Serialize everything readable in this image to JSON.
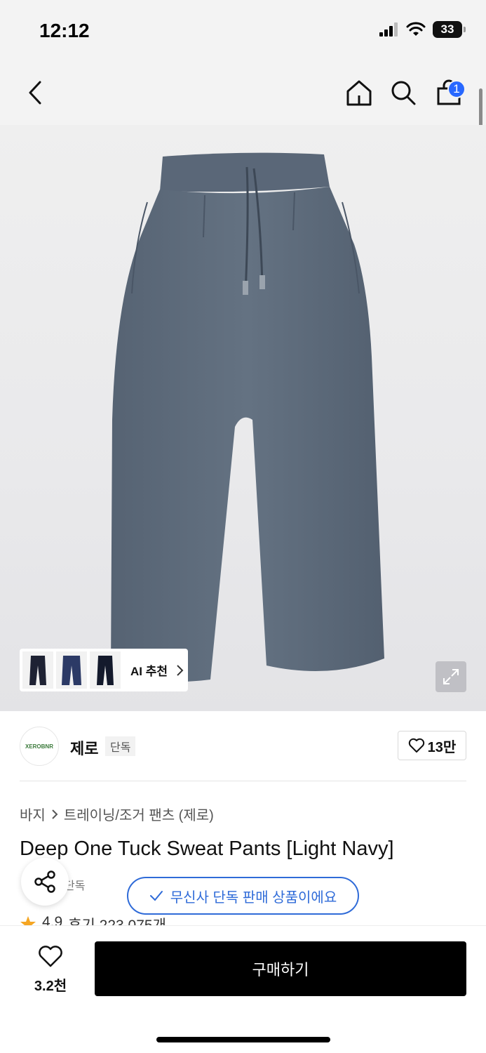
{
  "status_bar": {
    "time": "12:12",
    "battery": "33"
  },
  "navigation": {
    "cart_count": "1"
  },
  "hero": {
    "ai_recommend_label": "AI 추천",
    "product_color": "#5d6b7b"
  },
  "brand": {
    "logo_text": "XEROBNR",
    "name": "제로",
    "tag": "단독",
    "like_count": "13만"
  },
  "product": {
    "breadcrumb": [
      "바지",
      "트레이닝/조거 팬츠 (제로)"
    ],
    "title": "Deep One Tuck Sweat Pants [Light Navy]",
    "exclusive_tag": "단독",
    "exclusive_notice": "무신사 단독 판매 상품이에요",
    "rating": "4.9",
    "reviews_label": "후기 223,075개"
  },
  "bottom_bar": {
    "wish_count": "3.2천",
    "buy_label": "구매하기"
  },
  "colors": {
    "accent_blue": "#2f6bd8",
    "badge_blue": "#2868ff",
    "star": "#f5a623"
  }
}
